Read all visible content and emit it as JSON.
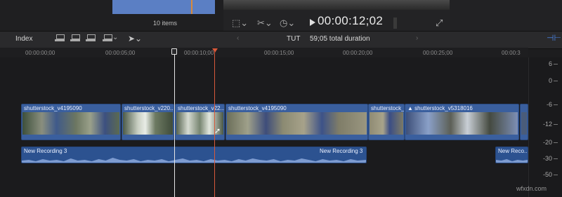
{
  "browser": {
    "items_count": "10 items"
  },
  "viewer": {
    "timecode": "00:00:12;02"
  },
  "toolbar": {
    "index_label": "Index",
    "project_name": "TUT",
    "duration": "59;05 total duration"
  },
  "ruler": {
    "ticks": [
      "00:00:00;00",
      "00:00:05;00",
      "00:00:10;00",
      "00:00:15;00",
      "00:00:20;00",
      "00:00:25;00",
      "00:00:3"
    ]
  },
  "clips": [
    {
      "title": "shutterstock_v4195090"
    },
    {
      "title": "shutterstock_v220..."
    },
    {
      "title": "shutterstock_v22..."
    },
    {
      "title": "shutterstock_v4195090"
    },
    {
      "title": "shutterstock_..."
    },
    {
      "title": "shutterstock_v5318016"
    }
  ],
  "audio": [
    {
      "title": "New Recording 3"
    },
    {
      "title": "New Recording 3"
    },
    {
      "title": "New Reco..."
    }
  ],
  "meter": {
    "labels": [
      "6",
      "0",
      "-6",
      "-12",
      "-20",
      "-30",
      "-50"
    ]
  },
  "watermark": "wfxdn.com",
  "colors": {
    "playhead": "#d7593a",
    "clip": "#3a5f9e",
    "audio": "#2c5290",
    "accent": "#4a86e8"
  }
}
